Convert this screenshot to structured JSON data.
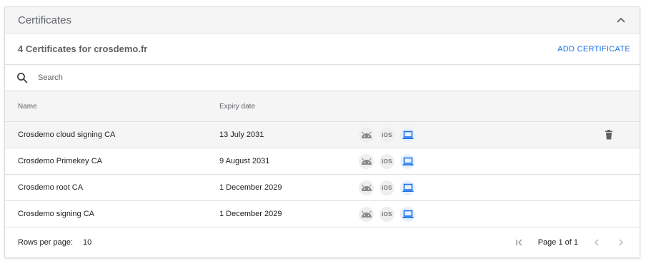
{
  "panel": {
    "title": "Certificates"
  },
  "summary": {
    "text": "4 Certificates for crosdemo.fr",
    "add_label": "ADD CERTIFICATE"
  },
  "search": {
    "placeholder": "Search",
    "value": ""
  },
  "table": {
    "headers": {
      "name": "Name",
      "expiry": "Expiry date"
    },
    "rows": [
      {
        "name": "Crosdemo cloud signing CA",
        "expiry": "13 July 2031",
        "highlighted": true
      },
      {
        "name": "Crosdemo Primekey CA",
        "expiry": "9 August 2031",
        "highlighted": false
      },
      {
        "name": "Crosdemo root CA",
        "expiry": "1 December 2029",
        "highlighted": false
      },
      {
        "name": "Crosdemo signing CA",
        "expiry": "1 December 2029",
        "highlighted": false
      }
    ],
    "platform_icons": [
      "android-icon",
      "ios-icon",
      "laptop-icon"
    ],
    "ios_label": "iOS"
  },
  "footer": {
    "rows_per_page_label": "Rows per page:",
    "rows_per_page_value": "10",
    "page_label": "Page 1 of 1"
  },
  "colors": {
    "accent": "#1a73e8",
    "icon_gray": "#757575",
    "header_bg": "#f5f5f5",
    "border": "#e0e0e0"
  }
}
